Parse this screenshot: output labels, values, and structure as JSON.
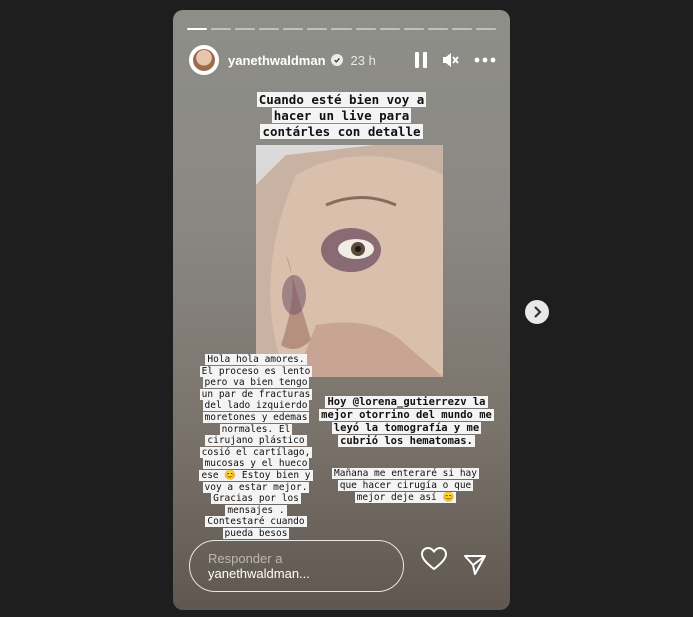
{
  "story": {
    "progress_segments": 13,
    "active_segment": 0,
    "username": "yanethwaldman",
    "verified": true,
    "time": "23 h",
    "icons": {
      "pause": "pause-icon",
      "mute": "muted-speaker-icon",
      "more": "more-dots-icon",
      "verified": "verified-badge-icon",
      "like": "heart-icon",
      "send": "send-icon",
      "next": "chevron-right-icon"
    },
    "caption_top": "Cuando esté bien voy a hacer un live para contárles con detalle",
    "caption_left": "Hola hola amores. El proceso es lento pero va bien tengo un par de fracturas del lado izquierdo moretones y edemas normales. El cirujano plástico cosió el cartílago, mucosas y el hueco ese 😊 Estoy bien y voy a estar mejor. Gracias por los mensajes . Contestaré cuando pueda besos",
    "caption_right1": "Hoy @lorena_gutierrezv la mejor otorrino del mundo me leyó la tomografía y me cubrió los hematomas.",
    "caption_right2": "Mañana me enteraré si hay que hacer cirugía o que mejor deje así 😊",
    "reply_label": "Responder a",
    "reply_user": "yanethwaldman..."
  }
}
